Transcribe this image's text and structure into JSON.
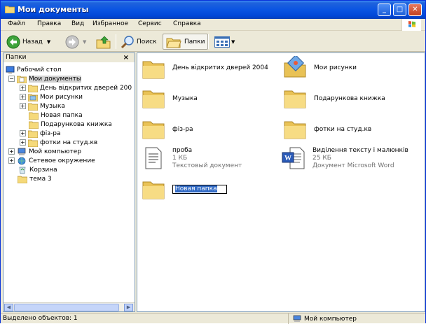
{
  "window": {
    "title": "Мои документы"
  },
  "menu": [
    "Файл",
    "Правка",
    "Вид",
    "Избранное",
    "Сервис",
    "Справка"
  ],
  "toolbar": {
    "back": "Назад",
    "search": "Поиск",
    "folders": "Папки"
  },
  "tree": {
    "header": "Папки",
    "close": "×",
    "items": [
      {
        "label": "Рабочий стол",
        "icon": "desktop-icon"
      },
      {
        "label": "Мои документы",
        "icon": "my-documents-icon",
        "expander": "−"
      },
      {
        "label": "День відкритих дверей 200",
        "icon": "folder-icon",
        "expander": "+"
      },
      {
        "label": "Мои рисунки",
        "icon": "my-pictures-icon",
        "expander": "+"
      },
      {
        "label": "Музыка",
        "icon": "folder-icon",
        "expander": "+"
      },
      {
        "label": "Новая папка",
        "icon": "folder-icon"
      },
      {
        "label": "Подарункова книжка",
        "icon": "folder-icon"
      },
      {
        "label": "фіз-ра",
        "icon": "folder-icon",
        "expander": "+"
      },
      {
        "label": "фотки на студ.кв",
        "icon": "folder-icon",
        "expander": "+"
      },
      {
        "label": "Мой компьютер",
        "icon": "my-computer-icon",
        "expander": "+"
      },
      {
        "label": "Сетевое окружение",
        "icon": "network-icon",
        "expander": "+"
      },
      {
        "label": "Корзина",
        "icon": "recycle-bin-icon"
      },
      {
        "label": "тема 3",
        "icon": "folder-icon"
      }
    ]
  },
  "files": [
    {
      "name": "День відкритих дверей 2004",
      "icon": "folder-icon"
    },
    {
      "name": "Мои рисунки",
      "icon": "my-pictures-icon"
    },
    {
      "name": "Музыка",
      "icon": "folder-icon"
    },
    {
      "name": "Подарункова книжка",
      "icon": "folder-icon"
    },
    {
      "name": "фіз-ра",
      "icon": "folder-icon"
    },
    {
      "name": "фотки на студ.кв",
      "icon": "folder-icon"
    },
    {
      "name": "проба",
      "size": "1 КБ",
      "type": "Текстовый документ",
      "icon": "text-document-icon"
    },
    {
      "name": "Виділення тексту і малюнків",
      "size": "25 КБ",
      "type": "Документ Microsoft Word",
      "icon": "word-document-icon"
    },
    {
      "name": "Новая папка",
      "icon": "folder-icon",
      "renaming": true
    }
  ],
  "status": {
    "left": "Выделено объектов: 1",
    "right": "Мой компьютер"
  },
  "colors": {
    "titlebar": "#0a54e2",
    "folder": "#f5d97a",
    "selection": "#316ac5"
  }
}
